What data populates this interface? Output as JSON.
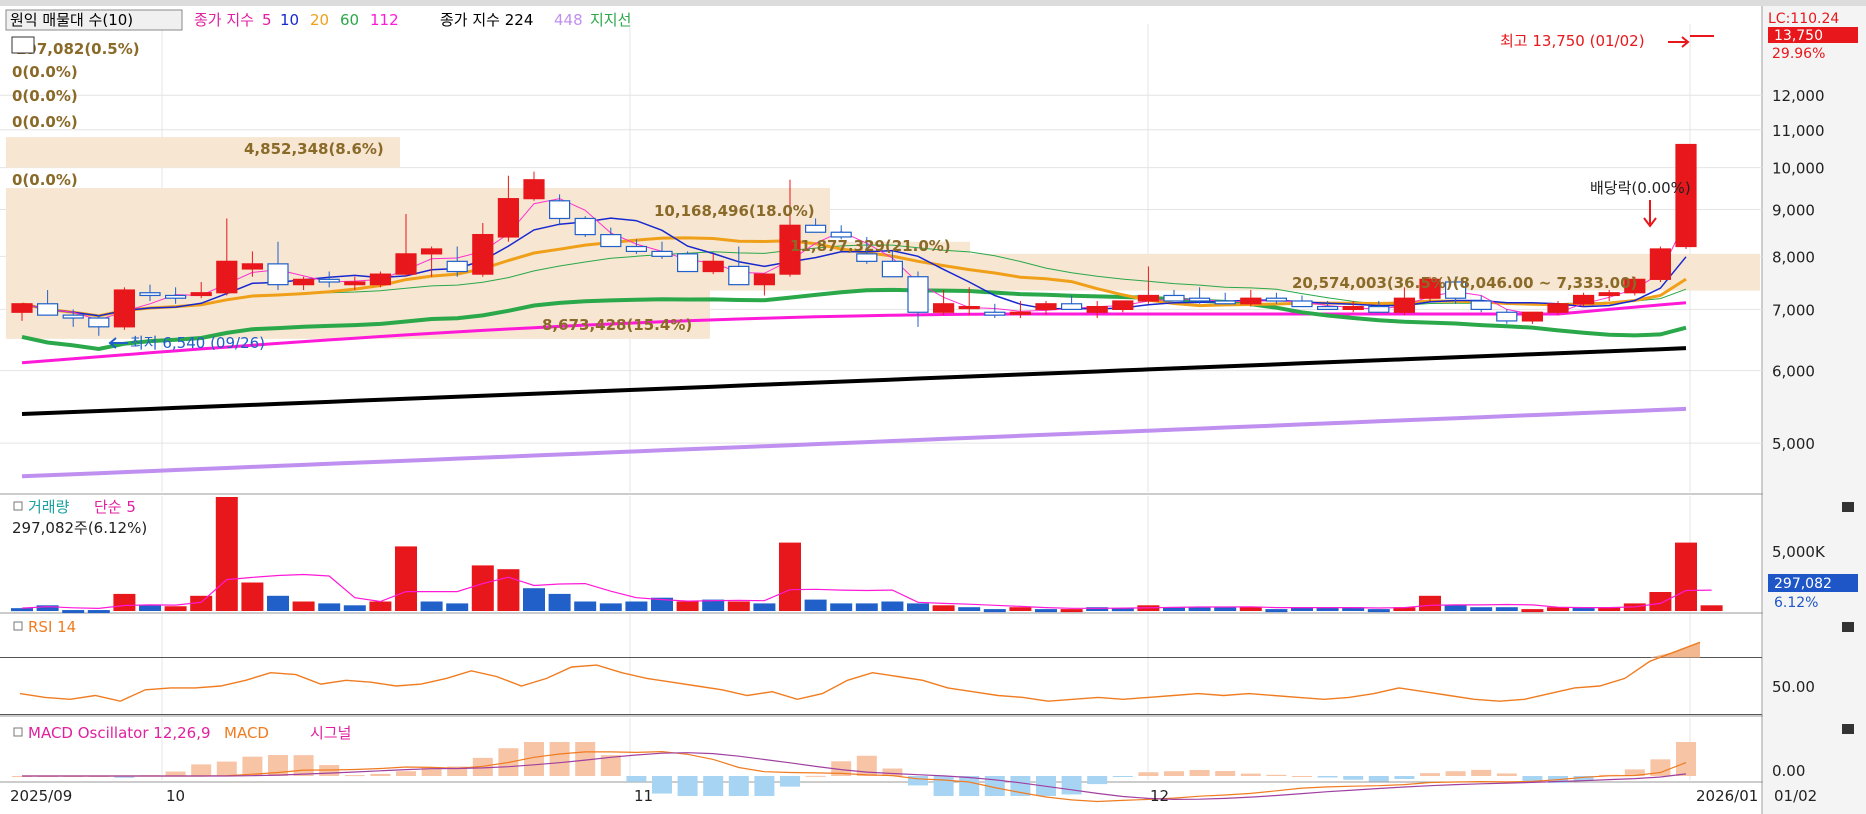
{
  "header": {
    "chk": "원익 매물대 수(10)",
    "ma_label": "종가 지수",
    "ma_periods": [
      "5",
      "10",
      "20",
      "60",
      "112"
    ],
    "ma2_label": "종가 지수 224",
    "ma2_b": "448",
    "support_label": "지지선"
  },
  "colors": {
    "up": "#e8171b",
    "down": "#2060c8",
    "ma5": "#ff2fd0",
    "ma10": "#1828d0",
    "ma20": "#f0a018",
    "ma60": "#2aa84a",
    "ma112": "#ff19d8",
    "ma224": "#000000",
    "ma448": "#c090f0",
    "vol_ma": "#ff19d8",
    "rsi": "#f07c20",
    "macd": "#f07c20",
    "signal": "#a040a0"
  },
  "profile_labels": [
    "297,082(0.5%)",
    "0(0.0%)",
    "0(0.0%)",
    "0(0.0%)",
    "4,852,348(8.6%)",
    "0(0.0%)",
    "10,168,496(18.0%)",
    "11,877,329(21.0%)",
    "20,574,003(36.5%)(8,046.00 ~ 7,333.00)",
    "8,673,428(15.4%)"
  ],
  "annotations": {
    "high": "최고 13,750 (01/02)",
    "low": "최저 6,540 (09/26)",
    "ex_div": "배당락(0.00%)"
  },
  "right_axis": {
    "top_label": "LC:110.24",
    "price_badge": "13,750",
    "price_pct": "29.96%",
    "price_ticks": [
      "12,000",
      "11,000",
      "10,000",
      "9,000",
      "8,000",
      "7,000",
      "6,000",
      "5,000"
    ],
    "vol_tick": "5,000K",
    "vol_badge": "297,082",
    "vol_pct": "6.12%",
    "rsi_tick": "50.00",
    "macd_tick": "0.00",
    "date_right": "01/02"
  },
  "volume_panel": {
    "title": "거래량",
    "ma": "단순 5",
    "value": "297,082주(6.12%)"
  },
  "rsi_panel": {
    "title": "RSI 14"
  },
  "macd_panel": {
    "title": "MACD Oscillator 12,26,9",
    "macd": "MACD",
    "signal": "시그널"
  },
  "x_axis": {
    "labels": [
      "2025/09",
      "10",
      "11",
      "12",
      "2026/01"
    ]
  },
  "chart_data": {
    "type": "candlestick",
    "y_scale": "log",
    "y_range": [
      4500,
      14500
    ],
    "candles": [
      [
        6950,
        7100,
        6800,
        7100
      ],
      [
        7100,
        7350,
        6950,
        6900
      ],
      [
        6900,
        7000,
        6700,
        6850
      ],
      [
        6850,
        6900,
        6550,
        6700
      ],
      [
        6700,
        7400,
        6650,
        7350
      ],
      [
        7300,
        7450,
        7150,
        7250
      ],
      [
        7250,
        7400,
        7100,
        7200
      ],
      [
        7250,
        7500,
        7200,
        7300
      ],
      [
        7300,
        8800,
        7250,
        7900
      ],
      [
        7750,
        8100,
        7600,
        7850
      ],
      [
        7850,
        8300,
        7350,
        7450
      ],
      [
        7450,
        7600,
        7350,
        7550
      ],
      [
        7550,
        7700,
        7400,
        7500
      ],
      [
        7450,
        7600,
        7350,
        7500
      ],
      [
        7450,
        7700,
        7400,
        7650
      ],
      [
        7650,
        8900,
        7600,
        8050
      ],
      [
        8050,
        8200,
        7600,
        8150
      ],
      [
        7900,
        8200,
        7600,
        7700
      ],
      [
        7650,
        8700,
        7600,
        8450
      ],
      [
        8400,
        9800,
        8300,
        9250
      ],
      [
        9250,
        9900,
        9200,
        9700
      ],
      [
        9200,
        9350,
        8650,
        8800
      ],
      [
        8800,
        8850,
        8400,
        8450
      ],
      [
        8450,
        8600,
        8250,
        8200
      ],
      [
        8200,
        8350,
        8050,
        8100
      ],
      [
        8100,
        8300,
        7950,
        8000
      ],
      [
        8050,
        8100,
        7700,
        7700
      ],
      [
        7700,
        8050,
        7650,
        7900
      ],
      [
        7800,
        8200,
        7700,
        7450
      ],
      [
        7450,
        7650,
        7250,
        7650
      ],
      [
        7650,
        9700,
        7600,
        8650
      ],
      [
        8650,
        8800,
        8500,
        8500
      ],
      [
        8500,
        8650,
        8350,
        8400
      ],
      [
        8050,
        8400,
        7850,
        7900
      ],
      [
        7900,
        8100,
        7700,
        7600
      ],
      [
        7600,
        7700,
        6700,
        6950
      ],
      [
        6950,
        7350,
        6900,
        7100
      ],
      [
        7050,
        7400,
        6900,
        7050
      ],
      [
        6950,
        7100,
        6850,
        6900
      ],
      [
        6950,
        7150,
        6850,
        6950
      ],
      [
        7000,
        7150,
        6900,
        7100
      ],
      [
        7100,
        7250,
        7050,
        7000
      ],
      [
        6950,
        7150,
        6850,
        7050
      ],
      [
        7000,
        7150,
        6950,
        7150
      ],
      [
        7150,
        7800,
        7100,
        7250
      ],
      [
        7250,
        7350,
        7150,
        7150
      ],
      [
        7200,
        7400,
        7100,
        7150
      ],
      [
        7150,
        7300,
        7100,
        7100
      ],
      [
        7100,
        7350,
        7050,
        7200
      ],
      [
        7200,
        7300,
        7100,
        7150
      ],
      [
        7150,
        7250,
        7050,
        7050
      ],
      [
        7050,
        7150,
        7000,
        7000
      ],
      [
        7000,
        7150,
        6950,
        7050
      ],
      [
        7050,
        7150,
        7000,
        6950
      ],
      [
        6950,
        7400,
        6900,
        7200
      ],
      [
        7200,
        7600,
        7150,
        7550
      ],
      [
        7500,
        7600,
        7100,
        7200
      ],
      [
        7150,
        7250,
        6950,
        7000
      ],
      [
        6950,
        7000,
        6750,
        6800
      ],
      [
        6800,
        6950,
        6750,
        6950
      ],
      [
        6950,
        7150,
        6900,
        7100
      ],
      [
        7100,
        7300,
        7050,
        7250
      ],
      [
        7250,
        7350,
        7150,
        7300
      ],
      [
        7300,
        7600,
        7250,
        7550
      ],
      [
        7550,
        8200,
        7500,
        8150
      ],
      [
        8200,
        10600,
        8150,
        10600
      ]
    ],
    "volume_bars": [
      [
        0.15,
        0
      ],
      [
        0.3,
        0
      ],
      [
        0.05,
        0
      ],
      [
        0.05,
        0
      ],
      [
        0.9,
        1
      ],
      [
        0.3,
        0
      ],
      [
        0.25,
        1
      ],
      [
        0.8,
        1
      ],
      [
        6.0,
        1
      ],
      [
        1.5,
        1
      ],
      [
        0.8,
        0
      ],
      [
        0.5,
        1
      ],
      [
        0.4,
        0
      ],
      [
        0.3,
        0
      ],
      [
        0.5,
        1
      ],
      [
        3.4,
        1
      ],
      [
        0.5,
        0
      ],
      [
        0.4,
        0
      ],
      [
        2.4,
        1
      ],
      [
        2.2,
        1
      ],
      [
        1.2,
        0
      ],
      [
        0.9,
        0
      ],
      [
        0.5,
        0
      ],
      [
        0.4,
        0
      ],
      [
        0.5,
        0
      ],
      [
        0.7,
        0
      ],
      [
        0.5,
        1
      ],
      [
        0.6,
        0
      ],
      [
        0.5,
        1
      ],
      [
        0.4,
        0
      ],
      [
        3.6,
        1
      ],
      [
        0.6,
        0
      ],
      [
        0.4,
        0
      ],
      [
        0.4,
        0
      ],
      [
        0.5,
        0
      ],
      [
        0.4,
        0
      ],
      [
        0.3,
        1
      ],
      [
        0.2,
        0
      ],
      [
        0.1,
        0
      ],
      [
        0.2,
        1
      ],
      [
        0.1,
        0
      ],
      [
        0.1,
        1
      ],
      [
        0.2,
        0
      ],
      [
        0.15,
        0
      ],
      [
        0.3,
        1
      ],
      [
        0.2,
        0
      ],
      [
        0.2,
        0
      ],
      [
        0.2,
        0
      ],
      [
        0.2,
        1
      ],
      [
        0.1,
        0
      ],
      [
        0.2,
        0
      ],
      [
        0.2,
        0
      ],
      [
        0.2,
        0
      ],
      [
        0.1,
        0
      ],
      [
        0.2,
        1
      ],
      [
        0.8,
        1
      ],
      [
        0.3,
        0
      ],
      [
        0.2,
        0
      ],
      [
        0.2,
        0
      ],
      [
        0.1,
        1
      ],
      [
        0.2,
        1
      ],
      [
        0.2,
        0
      ],
      [
        0.2,
        1
      ],
      [
        0.4,
        1
      ],
      [
        1.0,
        1
      ],
      [
        3.6,
        1
      ],
      [
        0.3,
        1
      ]
    ],
    "rsi": [
      46,
      44,
      43,
      45,
      42,
      48,
      49,
      49,
      50,
      53,
      57,
      56,
      51,
      53,
      52,
      50,
      51,
      54,
      58,
      55,
      50,
      54,
      60,
      61,
      57,
      54,
      52,
      50,
      48,
      45,
      47,
      43,
      46,
      53,
      57,
      55,
      53,
      49,
      47,
      45,
      44,
      42,
      43,
      44,
      43,
      44,
      45,
      46,
      45,
      46,
      45,
      44,
      43,
      44,
      46,
      49,
      47,
      45,
      43,
      42,
      43,
      46,
      49,
      50,
      54,
      63,
      68,
      73
    ]
  }
}
